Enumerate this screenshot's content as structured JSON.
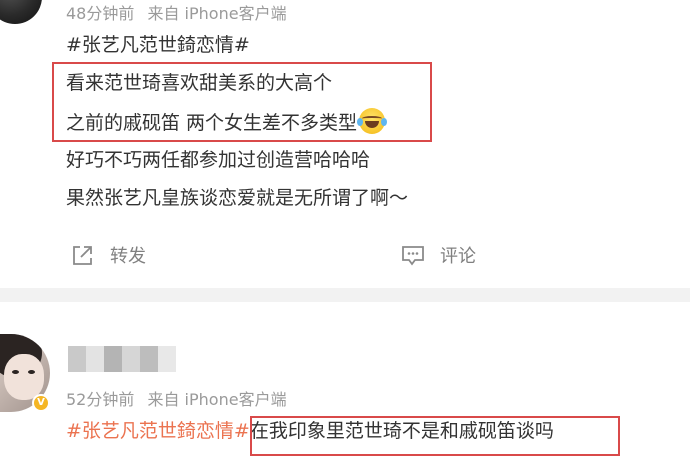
{
  "post1": {
    "time": "48分钟前",
    "source": "来自 iPhone客户端",
    "topic": "#张艺凡范世錡恋情#",
    "lines": [
      "看来范世琦喜欢甜美系的大高个",
      "之前的戚砚笛 两个女生差不多类型",
      "好巧不巧两任都参加过创造营哈哈哈",
      "果然张艺凡皇族谈恋爱就是无所谓了啊～"
    ],
    "emoji": "laughing-crying-emoji",
    "actions": {
      "repost_label": "转发",
      "comment_label": "评论"
    }
  },
  "post2": {
    "time": "52分钟前",
    "source": "来自 iPhone客户端",
    "topic": "#张艺凡范世錡恋情#",
    "text": "在我印象里范世琦不是和戚砚笛谈吗",
    "badge": "V"
  },
  "colors": {
    "topic": "#eb7350",
    "highlight_box": "#d94a4a",
    "meta_text": "#9a9a9a",
    "body_text": "#333333",
    "divider": "#f2f2f2",
    "verified_badge": "#f5b624"
  }
}
